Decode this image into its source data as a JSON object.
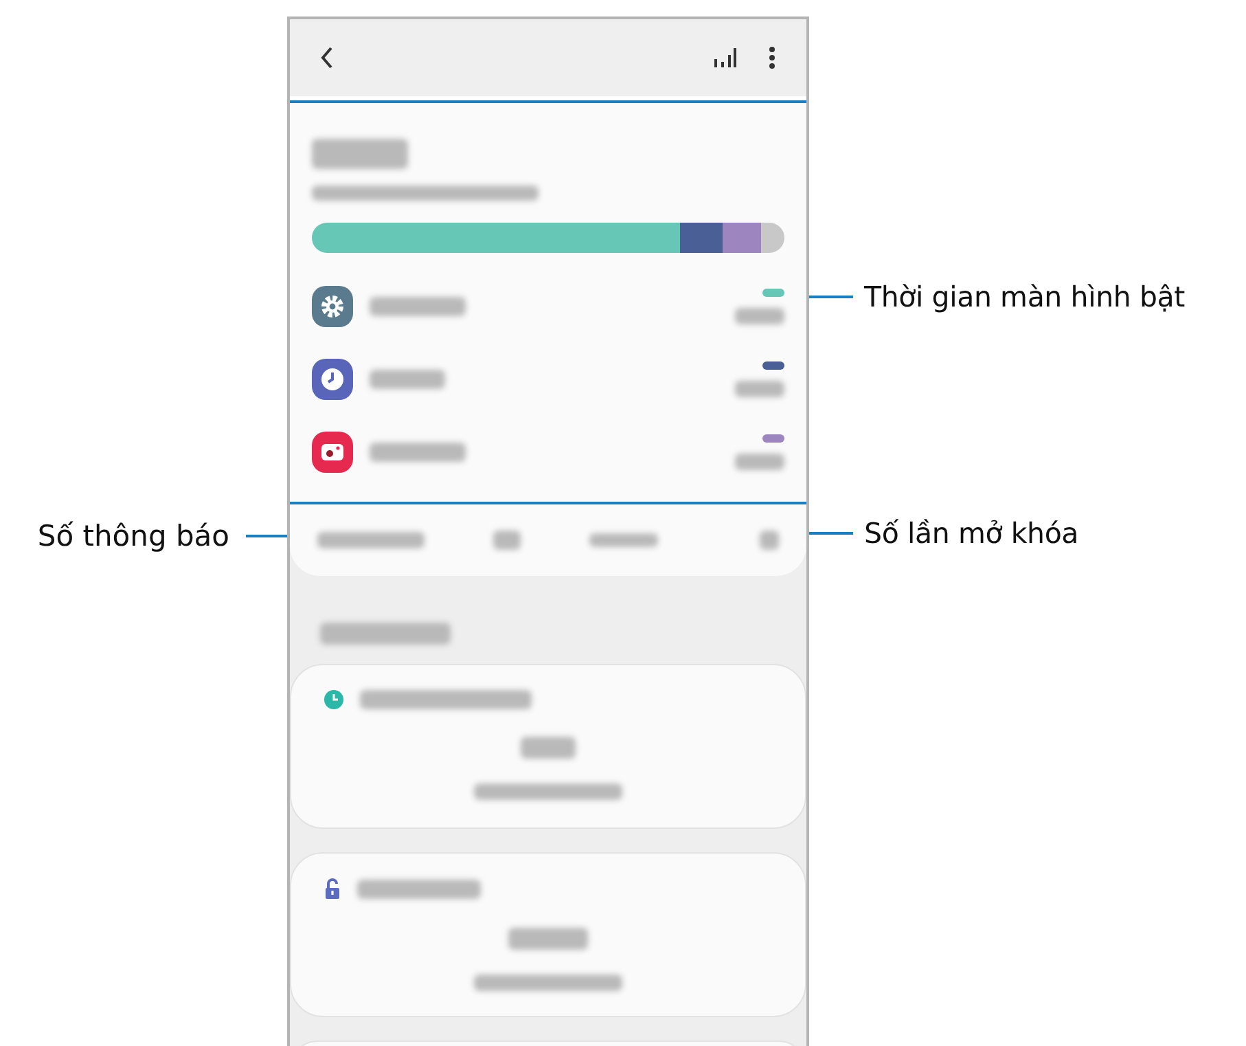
{
  "apps": [
    {
      "kind": "settings",
      "color": "#66c7b6"
    },
    {
      "kind": "clock",
      "color": "#4a5f96"
    },
    {
      "kind": "camera",
      "color": "#9d85bf"
    }
  ],
  "goals": [
    {
      "kind": "screen-time"
    },
    {
      "kind": "unlock"
    }
  ],
  "annotations": {
    "left": [
      {
        "label": "Số thông báo"
      }
    ],
    "right": [
      {
        "label": "Thời gian màn hình bật"
      },
      {
        "label": "Số lần mở khóa"
      }
    ]
  }
}
